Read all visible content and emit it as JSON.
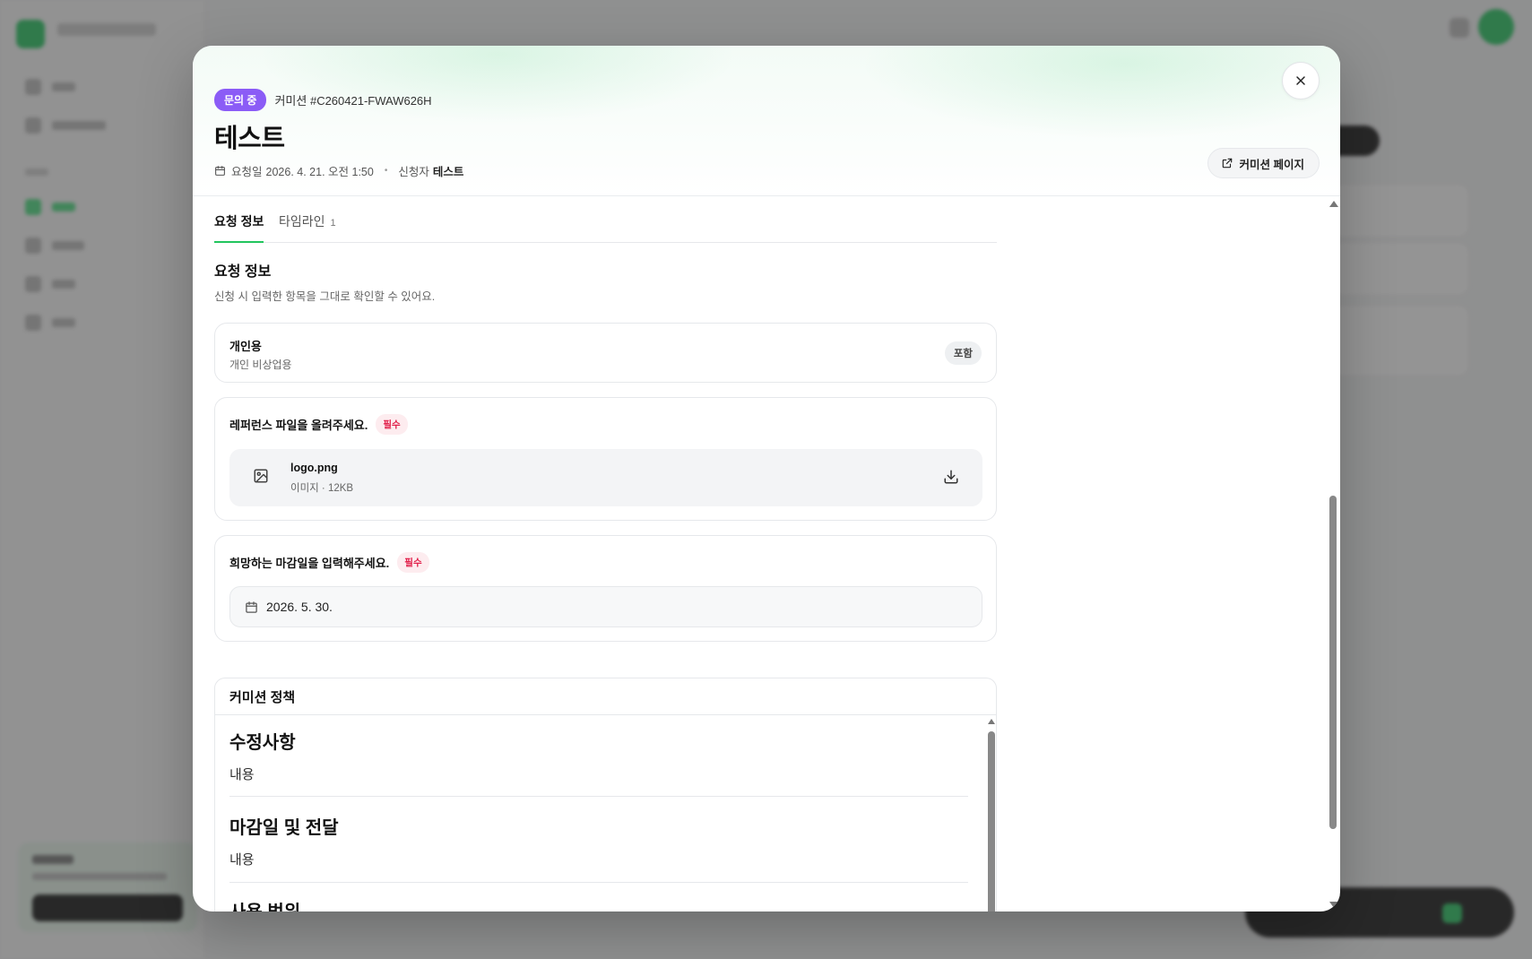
{
  "modal": {
    "status_badge": "문의 중",
    "commission_id": "커미션 #C260421-FWAW626H",
    "title": "테스트",
    "requested_label": "요청일",
    "requested_date": "2026. 4. 21. 오전 1:50",
    "separator": "•",
    "requester_label": "신청자",
    "requester_name": "테스트",
    "external_button": "커미션 페이지"
  },
  "tabs": [
    {
      "label": "요청 정보",
      "active": true
    },
    {
      "label": "타임라인",
      "count": "1",
      "active": false
    }
  ],
  "request_info": {
    "title": "요청 정보",
    "description": "신청 시 입력한 항목을 그대로 확인할 수 있어요.",
    "personal": {
      "title": "개인용",
      "subtitle": "개인 비상업용",
      "badge": "포함"
    },
    "reference": {
      "label": "레퍼런스 파일을 올려주세요.",
      "required": "필수",
      "file_name": "logo.png",
      "file_meta": "이미지 · 12KB"
    },
    "deadline": {
      "label": "희망하는 마감일을 입력해주세요.",
      "required": "필수",
      "value": "2026. 5. 30."
    }
  },
  "policy": {
    "title": "커미션 정책",
    "items": [
      {
        "heading": "수정사항",
        "body": "내용"
      },
      {
        "heading": "마감일 및 전달",
        "body": "내용"
      },
      {
        "heading": "사용 범위",
        "body": ""
      }
    ]
  },
  "colors": {
    "accent": "#22c55e",
    "status_badge": "#8b5cf6",
    "required": "#e11d48"
  }
}
